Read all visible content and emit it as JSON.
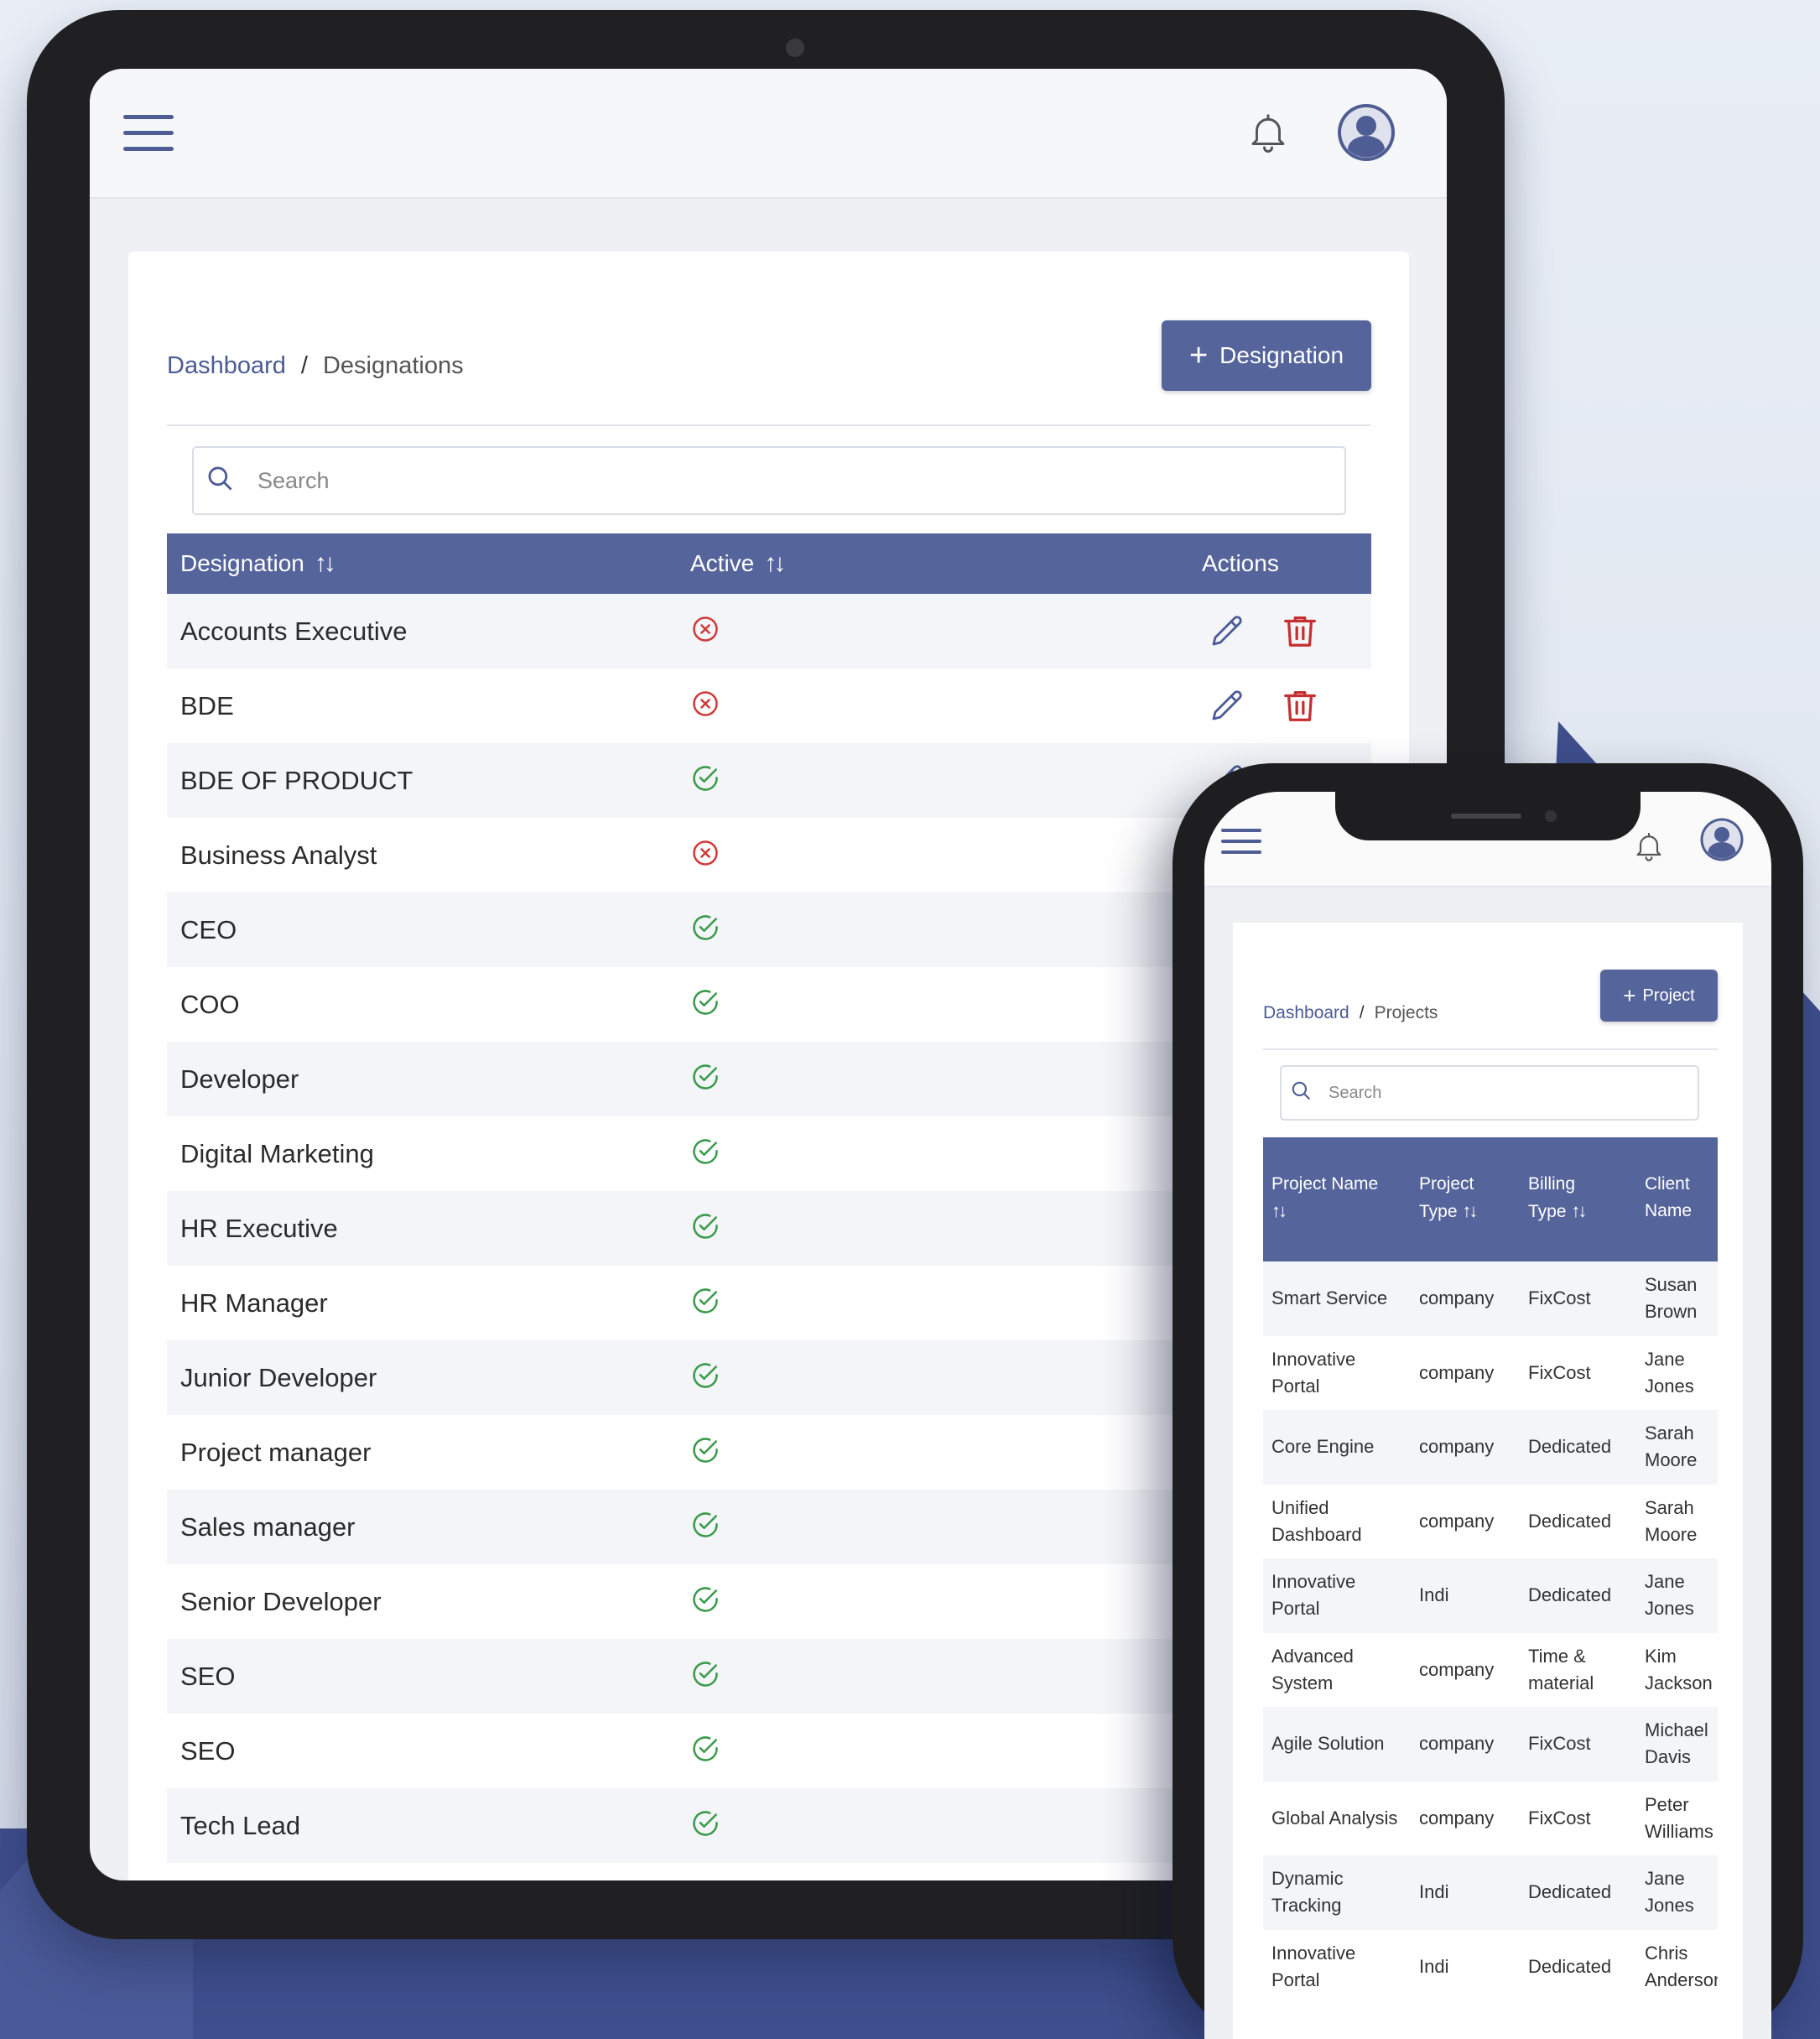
{
  "tablet": {
    "breadcrumb": {
      "root": "Dashboard",
      "separator": "/",
      "current": "Designations"
    },
    "add_button": "Designation",
    "search": {
      "placeholder": "Search"
    },
    "table": {
      "headers": {
        "designation": "Designation",
        "active": "Active",
        "actions": "Actions"
      },
      "rows": [
        {
          "name": "Accounts Executive",
          "active": false
        },
        {
          "name": "BDE",
          "active": false
        },
        {
          "name": "BDE OF PRODUCT",
          "active": true
        },
        {
          "name": "Business Analyst",
          "active": false
        },
        {
          "name": "CEO",
          "active": true
        },
        {
          "name": "COO",
          "active": true
        },
        {
          "name": "Developer",
          "active": true
        },
        {
          "name": "Digital Marketing",
          "active": true
        },
        {
          "name": "HR Executive",
          "active": true
        },
        {
          "name": "HR Manager",
          "active": true
        },
        {
          "name": "Junior Developer",
          "active": true
        },
        {
          "name": "Project manager",
          "active": true
        },
        {
          "name": "Sales manager",
          "active": true
        },
        {
          "name": "Senior Developer",
          "active": true
        },
        {
          "name": "SEO",
          "active": true
        },
        {
          "name": "SEO",
          "active": true
        },
        {
          "name": "Tech Lead",
          "active": true
        }
      ]
    }
  },
  "phone": {
    "breadcrumb": {
      "root": "Dashboard",
      "separator": "/",
      "current": "Projects"
    },
    "add_button": "Project",
    "search": {
      "placeholder": "Search"
    },
    "table": {
      "headers": {
        "project_name": "Project Name",
        "project_type_line1": "Project",
        "project_type_line2": "Type",
        "billing_type_line1": "Billing",
        "billing_type_line2": "Type",
        "client_name_line1": "Client",
        "client_name_line2": "Name"
      },
      "rows": [
        {
          "project": "Smart Service",
          "type": "company",
          "billing": "FixCost",
          "client": "Susan Brown"
        },
        {
          "project": "Innovative Portal",
          "type": "company",
          "billing": "FixCost",
          "client": "Jane Jones"
        },
        {
          "project": "Core Engine",
          "type": "company",
          "billing": "Dedicated",
          "client": "Sarah Moore"
        },
        {
          "project": "Unified Dashboard",
          "type": "company",
          "billing": "Dedicated",
          "client": "Sarah Moore"
        },
        {
          "project": "Innovative Portal",
          "type": "Indi",
          "billing": "Dedicated",
          "client": "Jane Jones"
        },
        {
          "project": "Advanced System",
          "type": "company",
          "billing": "Time & material",
          "client": "Kim Jackson"
        },
        {
          "project": "Agile Solution",
          "type": "company",
          "billing": "FixCost",
          "client": "Michael Davis"
        },
        {
          "project": "Global Analysis",
          "type": "company",
          "billing": "FixCost",
          "client": "Peter Williams"
        },
        {
          "project": "Dynamic Tracking",
          "type": "Indi",
          "billing": "Dedicated",
          "client": "Jane Jones"
        },
        {
          "project": "Innovative Portal",
          "type": "Indi",
          "billing": "Dedicated",
          "client": "Chris Anderson"
        }
      ]
    }
  },
  "icons": {
    "menu": "hamburger-icon",
    "notifications": "bell-icon",
    "profile": "user-avatar-icon",
    "search": "magnifier-icon",
    "edit": "pencil-icon",
    "delete": "trash-icon",
    "active": "check-circle-icon",
    "inactive": "x-circle-icon",
    "sort": "sort-arrows-icon"
  },
  "colors": {
    "primary": "#55649b",
    "active_green": "#3a9a4b",
    "inactive_red": "#d03a3a",
    "delete_red": "#c62f2f",
    "edit_blue": "#4b5b95"
  }
}
